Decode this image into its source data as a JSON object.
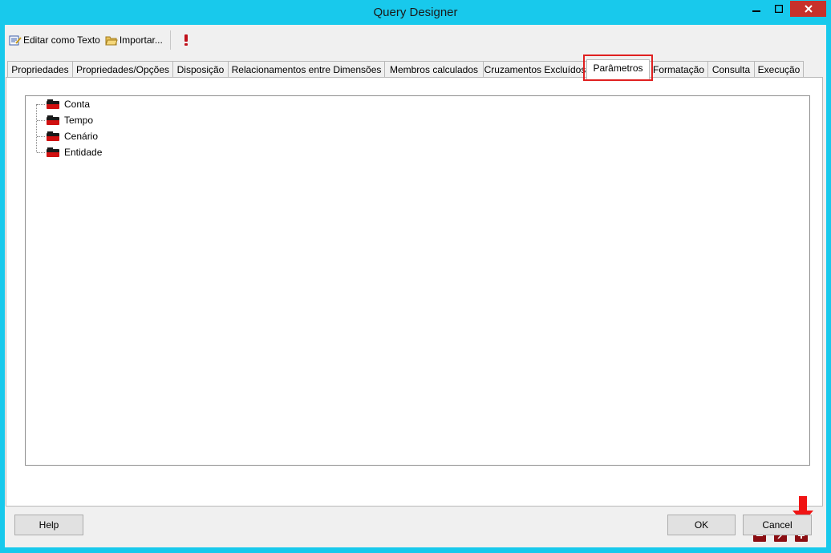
{
  "window": {
    "title": "Query Designer"
  },
  "toolbar": {
    "edit_as_text": "Editar como Texto",
    "import": "Importar...",
    "run_icon": "exclamation-icon"
  },
  "tabs": [
    {
      "label": "Propriedades"
    },
    {
      "label": "Propriedades/Opções"
    },
    {
      "label": "Disposição"
    },
    {
      "label": "Relacionamentos entre Dimensões"
    },
    {
      "label": "Membros calculados"
    },
    {
      "label": "Cruzamentos Excluídos"
    },
    {
      "label": "Parâmetros",
      "active": true
    },
    {
      "label": "Formatação"
    },
    {
      "label": "Consulta"
    },
    {
      "label": "Execução"
    }
  ],
  "tree": {
    "items": [
      {
        "label": "Conta"
      },
      {
        "label": "Tempo"
      },
      {
        "label": "Cenário"
      },
      {
        "label": "Entidade"
      }
    ]
  },
  "actions": {
    "remove_icon": "minus-icon",
    "edit_icon": "pencil-icon",
    "add_icon": "plus-icon"
  },
  "footer": {
    "help": "Help",
    "ok": "OK",
    "cancel": "Cancel"
  },
  "colors": {
    "titlebar": "#18c9ec",
    "close": "#c7312b",
    "action": "#8b0d12",
    "highlight": "#e02020"
  }
}
